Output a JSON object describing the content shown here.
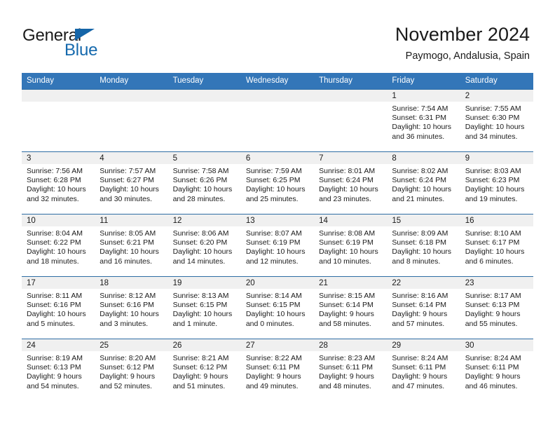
{
  "logo": {
    "text_primary": "General",
    "text_secondary": "Blue",
    "primary_color": "#1a1a1a",
    "secondary_color": "#1569ad",
    "triangle_color": "#1565a8"
  },
  "header": {
    "title": "November 2024",
    "subtitle": "Paymogo, Andalusia, Spain"
  },
  "theme": {
    "header_row_bg": "#3376b8",
    "header_row_text": "#ffffff",
    "daynum_band_bg": "#f0f0f0",
    "cell_border_top": "#2e6da4",
    "page_bg": "#ffffff"
  },
  "weekdays": [
    "Sunday",
    "Monday",
    "Tuesday",
    "Wednesday",
    "Thursday",
    "Friday",
    "Saturday"
  ],
  "weeks": [
    [
      {
        "day": "",
        "empty": true
      },
      {
        "day": "",
        "empty": true
      },
      {
        "day": "",
        "empty": true
      },
      {
        "day": "",
        "empty": true
      },
      {
        "day": "",
        "empty": true
      },
      {
        "day": "1",
        "sunrise": "Sunrise: 7:54 AM",
        "sunset": "Sunset: 6:31 PM",
        "daylight_line1": "Daylight: 10 hours",
        "daylight_line2": "and 36 minutes."
      },
      {
        "day": "2",
        "sunrise": "Sunrise: 7:55 AM",
        "sunset": "Sunset: 6:30 PM",
        "daylight_line1": "Daylight: 10 hours",
        "daylight_line2": "and 34 minutes."
      }
    ],
    [
      {
        "day": "3",
        "sunrise": "Sunrise: 7:56 AM",
        "sunset": "Sunset: 6:28 PM",
        "daylight_line1": "Daylight: 10 hours",
        "daylight_line2": "and 32 minutes."
      },
      {
        "day": "4",
        "sunrise": "Sunrise: 7:57 AM",
        "sunset": "Sunset: 6:27 PM",
        "daylight_line1": "Daylight: 10 hours",
        "daylight_line2": "and 30 minutes."
      },
      {
        "day": "5",
        "sunrise": "Sunrise: 7:58 AM",
        "sunset": "Sunset: 6:26 PM",
        "daylight_line1": "Daylight: 10 hours",
        "daylight_line2": "and 28 minutes."
      },
      {
        "day": "6",
        "sunrise": "Sunrise: 7:59 AM",
        "sunset": "Sunset: 6:25 PM",
        "daylight_line1": "Daylight: 10 hours",
        "daylight_line2": "and 25 minutes."
      },
      {
        "day": "7",
        "sunrise": "Sunrise: 8:01 AM",
        "sunset": "Sunset: 6:24 PM",
        "daylight_line1": "Daylight: 10 hours",
        "daylight_line2": "and 23 minutes."
      },
      {
        "day": "8",
        "sunrise": "Sunrise: 8:02 AM",
        "sunset": "Sunset: 6:24 PM",
        "daylight_line1": "Daylight: 10 hours",
        "daylight_line2": "and 21 minutes."
      },
      {
        "day": "9",
        "sunrise": "Sunrise: 8:03 AM",
        "sunset": "Sunset: 6:23 PM",
        "daylight_line1": "Daylight: 10 hours",
        "daylight_line2": "and 19 minutes."
      }
    ],
    [
      {
        "day": "10",
        "sunrise": "Sunrise: 8:04 AM",
        "sunset": "Sunset: 6:22 PM",
        "daylight_line1": "Daylight: 10 hours",
        "daylight_line2": "and 18 minutes."
      },
      {
        "day": "11",
        "sunrise": "Sunrise: 8:05 AM",
        "sunset": "Sunset: 6:21 PM",
        "daylight_line1": "Daylight: 10 hours",
        "daylight_line2": "and 16 minutes."
      },
      {
        "day": "12",
        "sunrise": "Sunrise: 8:06 AM",
        "sunset": "Sunset: 6:20 PM",
        "daylight_line1": "Daylight: 10 hours",
        "daylight_line2": "and 14 minutes."
      },
      {
        "day": "13",
        "sunrise": "Sunrise: 8:07 AM",
        "sunset": "Sunset: 6:19 PM",
        "daylight_line1": "Daylight: 10 hours",
        "daylight_line2": "and 12 minutes."
      },
      {
        "day": "14",
        "sunrise": "Sunrise: 8:08 AM",
        "sunset": "Sunset: 6:19 PM",
        "daylight_line1": "Daylight: 10 hours",
        "daylight_line2": "and 10 minutes."
      },
      {
        "day": "15",
        "sunrise": "Sunrise: 8:09 AM",
        "sunset": "Sunset: 6:18 PM",
        "daylight_line1": "Daylight: 10 hours",
        "daylight_line2": "and 8 minutes."
      },
      {
        "day": "16",
        "sunrise": "Sunrise: 8:10 AM",
        "sunset": "Sunset: 6:17 PM",
        "daylight_line1": "Daylight: 10 hours",
        "daylight_line2": "and 6 minutes."
      }
    ],
    [
      {
        "day": "17",
        "sunrise": "Sunrise: 8:11 AM",
        "sunset": "Sunset: 6:16 PM",
        "daylight_line1": "Daylight: 10 hours",
        "daylight_line2": "and 5 minutes."
      },
      {
        "day": "18",
        "sunrise": "Sunrise: 8:12 AM",
        "sunset": "Sunset: 6:16 PM",
        "daylight_line1": "Daylight: 10 hours",
        "daylight_line2": "and 3 minutes."
      },
      {
        "day": "19",
        "sunrise": "Sunrise: 8:13 AM",
        "sunset": "Sunset: 6:15 PM",
        "daylight_line1": "Daylight: 10 hours",
        "daylight_line2": "and 1 minute."
      },
      {
        "day": "20",
        "sunrise": "Sunrise: 8:14 AM",
        "sunset": "Sunset: 6:15 PM",
        "daylight_line1": "Daylight: 10 hours",
        "daylight_line2": "and 0 minutes."
      },
      {
        "day": "21",
        "sunrise": "Sunrise: 8:15 AM",
        "sunset": "Sunset: 6:14 PM",
        "daylight_line1": "Daylight: 9 hours",
        "daylight_line2": "and 58 minutes."
      },
      {
        "day": "22",
        "sunrise": "Sunrise: 8:16 AM",
        "sunset": "Sunset: 6:14 PM",
        "daylight_line1": "Daylight: 9 hours",
        "daylight_line2": "and 57 minutes."
      },
      {
        "day": "23",
        "sunrise": "Sunrise: 8:17 AM",
        "sunset": "Sunset: 6:13 PM",
        "daylight_line1": "Daylight: 9 hours",
        "daylight_line2": "and 55 minutes."
      }
    ],
    [
      {
        "day": "24",
        "sunrise": "Sunrise: 8:19 AM",
        "sunset": "Sunset: 6:13 PM",
        "daylight_line1": "Daylight: 9 hours",
        "daylight_line2": "and 54 minutes."
      },
      {
        "day": "25",
        "sunrise": "Sunrise: 8:20 AM",
        "sunset": "Sunset: 6:12 PM",
        "daylight_line1": "Daylight: 9 hours",
        "daylight_line2": "and 52 minutes."
      },
      {
        "day": "26",
        "sunrise": "Sunrise: 8:21 AM",
        "sunset": "Sunset: 6:12 PM",
        "daylight_line1": "Daylight: 9 hours",
        "daylight_line2": "and 51 minutes."
      },
      {
        "day": "27",
        "sunrise": "Sunrise: 8:22 AM",
        "sunset": "Sunset: 6:11 PM",
        "daylight_line1": "Daylight: 9 hours",
        "daylight_line2": "and 49 minutes."
      },
      {
        "day": "28",
        "sunrise": "Sunrise: 8:23 AM",
        "sunset": "Sunset: 6:11 PM",
        "daylight_line1": "Daylight: 9 hours",
        "daylight_line2": "and 48 minutes."
      },
      {
        "day": "29",
        "sunrise": "Sunrise: 8:24 AM",
        "sunset": "Sunset: 6:11 PM",
        "daylight_line1": "Daylight: 9 hours",
        "daylight_line2": "and 47 minutes."
      },
      {
        "day": "30",
        "sunrise": "Sunrise: 8:24 AM",
        "sunset": "Sunset: 6:11 PM",
        "daylight_line1": "Daylight: 9 hours",
        "daylight_line2": "and 46 minutes."
      }
    ]
  ]
}
